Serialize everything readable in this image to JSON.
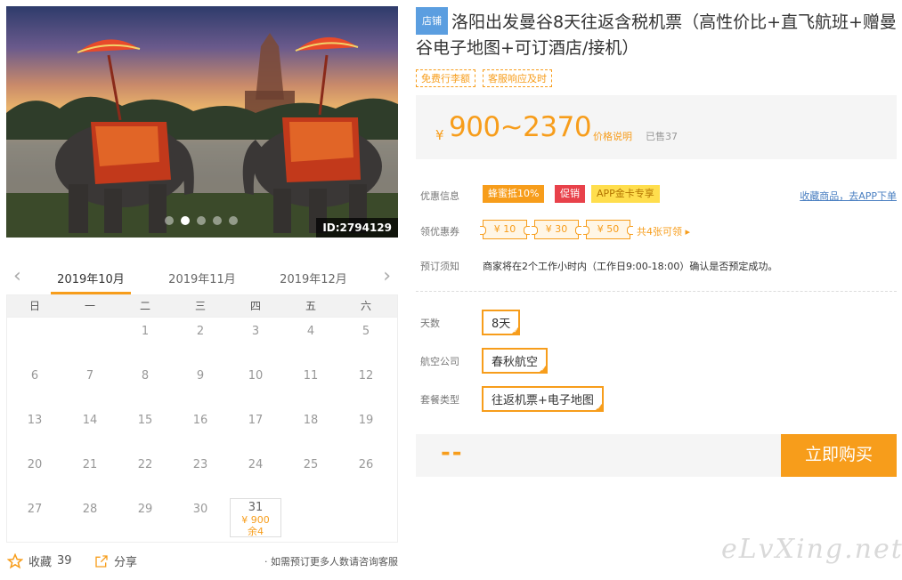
{
  "hero": {
    "image_id": "ID:2794129",
    "dots": 5,
    "active_dot": 1
  },
  "calendar": {
    "months": [
      "2019年10月",
      "2019年11月",
      "2019年12月"
    ],
    "active_month": 0,
    "weekdays": [
      "日",
      "一",
      "二",
      "三",
      "四",
      "五",
      "六"
    ],
    "weeks": [
      [
        "",
        "",
        "1",
        "2",
        "3",
        "4",
        "5"
      ],
      [
        "6",
        "7",
        "8",
        "9",
        "10",
        "11",
        "12"
      ],
      [
        "13",
        "14",
        "15",
        "16",
        "17",
        "18",
        "19"
      ],
      [
        "20",
        "21",
        "22",
        "23",
        "24",
        "25",
        "26"
      ],
      [
        "27",
        "28",
        "29",
        "30",
        "31",
        "",
        ""
      ]
    ],
    "available": {
      "day": "31",
      "price": "¥ 900",
      "remaining": "余4"
    }
  },
  "bottom": {
    "favorite_label": "收藏",
    "favorite_count": "39",
    "share_label": "分享",
    "consult_text": "· 如需预订更多人数请咨询客服"
  },
  "product": {
    "store_badge": "店铺",
    "title": "洛阳出发曼谷8天往返含税机票（高性价比+直飞航班+赠曼谷电子地图+可订酒店/接机）",
    "tags": [
      "免费行李额",
      "客服响应及时"
    ],
    "currency": "¥",
    "price": "900~2370",
    "price_note": "价格说明",
    "sold": "已售37"
  },
  "info": {
    "promo_label": "优惠信息",
    "promos": [
      "蜂蜜抵10%",
      "促销",
      "APP金卡专享"
    ],
    "save_link": "收藏商品，去APP下单",
    "coupon_label": "领优惠券",
    "coupons": [
      "¥ 10",
      "¥ 30",
      "¥ 50"
    ],
    "coupon_more": "共4张可领 ▸",
    "notice_label": "预订须知",
    "notice_text": "商家将在2个工作小时内（工作日9:00-18:00）确认是否预定成功。"
  },
  "options": {
    "days_label": "天数",
    "days_value": "8天",
    "airline_label": "航空公司",
    "airline_value": "春秋航空",
    "package_label": "套餐类型",
    "package_value": "往返机票+电子地图"
  },
  "purchase": {
    "quantity_placeholder": "--",
    "buy_label": "立即购买"
  },
  "watermark": "eLvXing.net",
  "colors": {
    "accent": "#f79d1b",
    "promo_red": "#e8414a",
    "promo_yellow": "#ffde4d",
    "store_blue": "#5b9ee0",
    "link_blue": "#4a7fc1"
  }
}
